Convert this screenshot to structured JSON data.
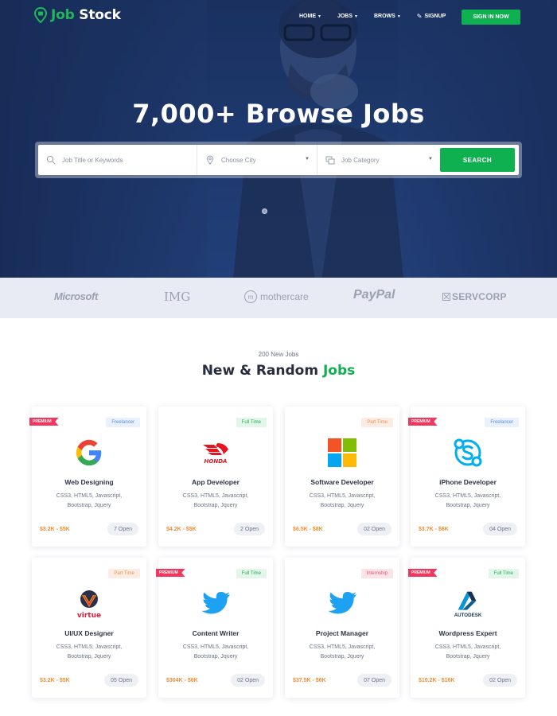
{
  "brand": {
    "name_part1": "Job",
    "name_part2": "Stock"
  },
  "nav": {
    "items": [
      {
        "label": "HOME",
        "dropdown": true
      },
      {
        "label": "JOBS",
        "dropdown": true
      },
      {
        "label": "BROWS",
        "dropdown": true
      },
      {
        "label": "SIGNUP",
        "dropdown": false
      }
    ],
    "signin_label": "SIGN IN NOW"
  },
  "hero": {
    "title": "7,000+ Browse Jobs",
    "search": {
      "keyword_placeholder": "Job Title or Keywords",
      "city_placeholder": "Choose City",
      "category_placeholder": "Job Category",
      "button_label": "SEARCH"
    }
  },
  "brands": [
    "Microsoft",
    "IMG",
    "mothercare",
    "PayPal",
    "SERVCORP"
  ],
  "section": {
    "subtitle": "200 New Jobs",
    "title_part1": "New & Random",
    "title_part2": "Jobs"
  },
  "jobs": [
    {
      "title": "Web Designing",
      "skills": "CSS3, HTML5, Javascript, Bootstrap, Jquery",
      "salary": "$3.2K - $5K",
      "open": "7 Open",
      "type": "Freelancer",
      "premium": true,
      "logo": "google-logo"
    },
    {
      "title": "App Developer",
      "skills": "CSS3, HTML5, Javascript, Bootstrap, Jquery",
      "salary": "$4.2K - $5K",
      "open": "2 Open",
      "type": "Full Time",
      "premium": false,
      "logo": "honda-logo"
    },
    {
      "title": "Software Developer",
      "skills": "CSS3, HTML5, Javascript, Bootstrap, Jquery",
      "salary": "$6.5K - $8K",
      "open": "02 Open",
      "type": "Part Time",
      "premium": false,
      "logo": "microsoft-logo"
    },
    {
      "title": "iPhone Developer",
      "skills": "CSS3, HTML5, Javascript, Bootstrap, Jquery",
      "salary": "$3.7K - $6K",
      "open": "04 Open",
      "type": "Freelancer",
      "premium": true,
      "logo": "skype-logo"
    },
    {
      "title": "UI/UX Designer",
      "skills": "CSS3, HTML5, Javascript, Bootstrap, Jquery",
      "salary": "$3.2K - $5K",
      "open": "05 Open",
      "type": "Part Time",
      "premium": false,
      "logo": "virtue-logo"
    },
    {
      "title": "Content Writer",
      "skills": "CSS3, HTML5, Javascript, Bootstrap, Jquery",
      "salary": "$304K - $6K",
      "open": "02 Open",
      "type": "Full Time",
      "premium": true,
      "logo": "twitter-logo"
    },
    {
      "title": "Project Manager",
      "skills": "CSS3, HTML5, Javascript, Bootstrap, Jquery",
      "salary": "$37.5K - $6K",
      "open": "07 Open",
      "type": "Internship",
      "premium": false,
      "logo": "twitter-logo"
    },
    {
      "title": "Wordpress Expert",
      "skills": "CSS3, HTML5, Javascript, Bootstrap, Jquery",
      "salary": "$10.2K - $16K",
      "open": "02 Open",
      "type": "Full Time",
      "premium": true,
      "logo": "autodesk-logo"
    }
  ],
  "labels": {
    "premium": "PREMIUM",
    "honda": "HONDA",
    "virtue": "virtue",
    "autodesk": "AUTODESK"
  },
  "colors": {
    "accent": "#0fb04f",
    "salary": "#f38c34",
    "premium": "#f2365d",
    "hero": "#213e72"
  }
}
